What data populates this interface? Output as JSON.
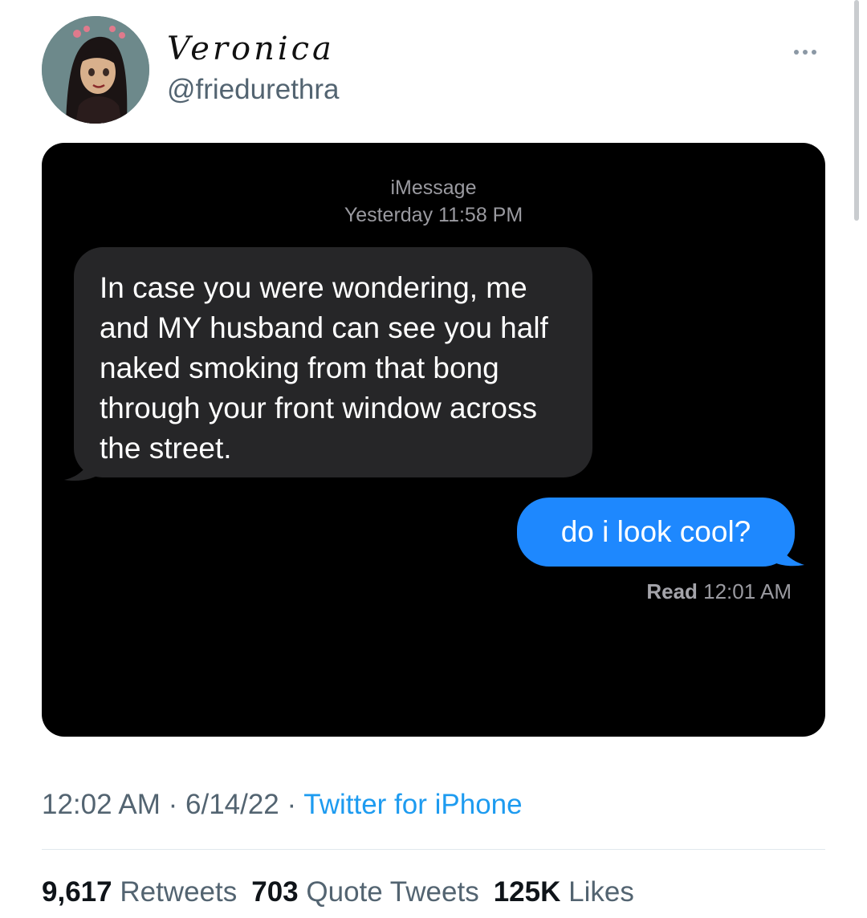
{
  "tweet": {
    "display_name": "Veronica",
    "handle": "@friedurethra",
    "more_icon": "more-horizontal-icon",
    "avatar_icon": "cartoon-avatar"
  },
  "imessage": {
    "service": "iMessage",
    "timestamp": "Yesterday 11:58 PM",
    "incoming_message": "In case you were wondering, me and MY husband can see you half naked smoking from that bong through your front window across the street.",
    "outgoing_message": "do i look cool?",
    "read_label": "Read",
    "read_time": "12:01 AM",
    "colors": {
      "background": "#000000",
      "incoming_bubble": "#262628",
      "outgoing_bubble": "#1e88fe"
    }
  },
  "meta": {
    "time": "12:02 AM",
    "separator": " · ",
    "date": "6/14/22",
    "source": "Twitter for iPhone",
    "source_color": "#1d9bf0"
  },
  "stats": {
    "retweets_count": "9,617",
    "retweets_label": "Retweets",
    "quotes_count": "703",
    "quotes_label": "Quote Tweets",
    "likes_count": "125K",
    "likes_label": "Likes"
  }
}
